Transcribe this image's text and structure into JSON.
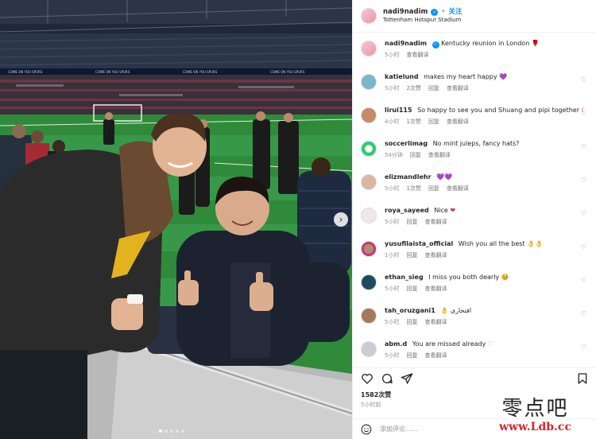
{
  "post": {
    "username": "nadi9nadim",
    "follow_label": "关注",
    "location": "Tottenham Hotspur Stadium",
    "caption": "Kentucky reunion in London",
    "caption_time": "5小时",
    "caption_translate": "查看翻译",
    "likes": "1582次赞",
    "posted": "5小时前",
    "add_comment_placeholder": "添加评论……"
  },
  "photo": {
    "banner_text": "COME ON YOU SPURS"
  },
  "comments": [
    {
      "user": "katielund",
      "text": "makes my heart happy",
      "emoji": "💜",
      "emoji_color": "purple",
      "time": "5小时",
      "likes": "2次赞",
      "reply": "回复",
      "translate": "查看翻译"
    },
    {
      "user": "lirui115",
      "text": "So happy to see you and Shuang and pipi together",
      "emoji": "😍",
      "emoji_color": "red",
      "time": "4小时",
      "likes": "1次赞",
      "reply": "回复",
      "translate": "查看翻译"
    },
    {
      "user": "soccerlimag",
      "text": "No mint juleps, fancy hats?",
      "emoji": "",
      "emoji_color": "",
      "time": "54分钟",
      "likes": "",
      "reply": "回复",
      "translate": "查看翻译"
    },
    {
      "user": "elizmandlehr",
      "text": "",
      "emoji": "💜💜",
      "emoji_color": "purple",
      "time": "5小时",
      "likes": "1次赞",
      "reply": "回复",
      "translate": "查看翻译"
    },
    {
      "user": "roya_sayeed",
      "text": "Nice",
      "emoji": "❤",
      "emoji_color": "red",
      "time": "5小时",
      "likes": "",
      "reply": "回复",
      "translate": "查看翻译"
    },
    {
      "user": "yusufilaista_official",
      "text": "Wish you all the best",
      "emoji": "👌👌",
      "emoji_color": "orange",
      "time": "1小时",
      "likes": "",
      "reply": "回复",
      "translate": "查看翻译"
    },
    {
      "user": "ethan_sieg",
      "text": "I miss you both dearly",
      "emoji": "🥹",
      "emoji_color": "yellow",
      "time": "5小时",
      "likes": "",
      "reply": "回复",
      "translate": "查看翻译"
    },
    {
      "user": "tah_oruzgani1",
      "text": "افتخاری",
      "emoji": "👌",
      "emoji_color": "orange",
      "time": "5小时",
      "likes": "",
      "reply": "回复",
      "translate": "查看翻译"
    },
    {
      "user": "abm.d",
      "text": "You are missed already",
      "emoji": "♡",
      "emoji_color": "grey",
      "time": "5小时",
      "likes": "",
      "reply": "回复",
      "translate": "查看翻译"
    }
  ],
  "icons": {
    "like": "heart-icon",
    "comment": "comment-icon",
    "share": "share-icon",
    "save": "bookmark-icon",
    "emoji": "smile-icon",
    "next": "chevron-right-icon"
  },
  "colors": {
    "accent": "#0095f6",
    "text": "#262626",
    "muted": "#8e8e8e",
    "divider": "#efefef"
  },
  "watermark": {
    "brand": "零点吧",
    "url": "www.Ldb.cc"
  }
}
